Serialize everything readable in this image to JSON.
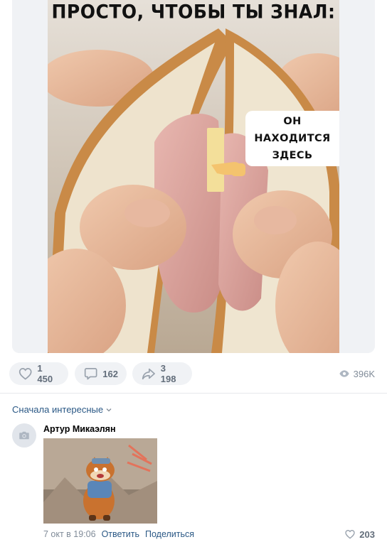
{
  "post": {
    "meme_caption": "ПРОСТО, ЧТОБЫ ТЫ ЗНАЛ:",
    "callout_lines": [
      "ОН",
      "НАХОДИТСЯ",
      "ЗДЕСЬ"
    ]
  },
  "actions": {
    "likes": "1 450",
    "comments": "162",
    "shares": "3 198",
    "views": "396K"
  },
  "comments": {
    "sort_label": "Сначала интересные",
    "items": [
      {
        "author": "Артур Микаэлян",
        "date": "7 окт в 19:06",
        "reply_label": "Ответить",
        "share_label": "Поделиться",
        "likes": "203"
      }
    ]
  },
  "colors": {
    "link": "#2a5885",
    "secondary": "#818c99",
    "button_bg": "#f0f2f5"
  },
  "icons": {
    "like": "heart-icon",
    "comment": "comment-bubble-icon",
    "share": "share-arrow-icon",
    "views": "eye-icon",
    "avatar": "camera-icon",
    "sort": "chevron-down-icon"
  }
}
